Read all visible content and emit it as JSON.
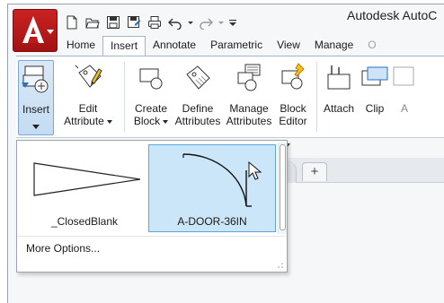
{
  "window": {
    "title": "Autodesk AutoC"
  },
  "app_menu": {
    "logo_letter": "A",
    "brand_color": "#c0191c"
  },
  "quick_access": {
    "icons": [
      "new-icon",
      "open-icon",
      "save-icon",
      "save-as-icon",
      "plot-icon",
      "undo-icon",
      "redo-icon",
      "customize-icon"
    ]
  },
  "tabs": [
    {
      "label": "Home",
      "active": false
    },
    {
      "label": "Insert",
      "active": true
    },
    {
      "label": "Annotate",
      "active": false
    },
    {
      "label": "Parametric",
      "active": false
    },
    {
      "label": "View",
      "active": false
    },
    {
      "label": "Manage",
      "active": false
    },
    {
      "label": "O",
      "active": false
    }
  ],
  "ribbon": {
    "insert": {
      "line1": "Insert"
    },
    "edit_attribute": {
      "line1": "Edit",
      "line2": "Attribute"
    },
    "create_block": {
      "line1": "Create",
      "line2": "Block"
    },
    "define_attributes": {
      "line1": "Define",
      "line2": "Attributes"
    },
    "manage_attributes": {
      "line1": "Manage",
      "line2": "Attributes"
    },
    "block_editor": {
      "line1": "Block",
      "line2": "Editor"
    },
    "attach": {
      "line1": "Attach"
    },
    "clip": {
      "line1": "Clip"
    },
    "partial": {
      "line1": "A"
    }
  },
  "gallery": {
    "items": [
      {
        "name": "_ClosedBlank",
        "selected": false
      },
      {
        "name": "A-DOOR-36IN",
        "selected": true
      }
    ],
    "more_options": "More Options..."
  },
  "doc_tabs": {
    "new_tab_glyph": "+"
  },
  "colors": {
    "selection_bg": "#cbe6f8",
    "selection_border": "#5aa8e0",
    "ribbon_border": "#a7b4c2"
  }
}
